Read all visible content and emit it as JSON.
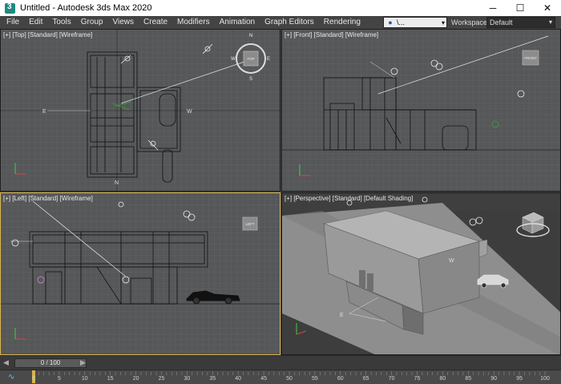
{
  "window": {
    "title": "Untitled - Autodesk 3ds Max 2020",
    "minimize_glyph": "─",
    "maximize_glyph": "☐",
    "close_glyph": "✕"
  },
  "menu": {
    "items": [
      {
        "label": "File"
      },
      {
        "label": "Edit"
      },
      {
        "label": "Tools"
      },
      {
        "label": "Group"
      },
      {
        "label": "Views"
      },
      {
        "label": "Create"
      },
      {
        "label": "Modifiers"
      },
      {
        "label": "Animation"
      },
      {
        "label": "Graph Editors"
      },
      {
        "label": "Rendering"
      }
    ],
    "user_value": "\\...",
    "workspaces_label": "Workspaces:",
    "workspaces_value": "Default"
  },
  "viewports": {
    "top": {
      "label": "[+] [Top] [Standard] [Wireframe]"
    },
    "front": {
      "label": "[+] [Front] [Standard] [Wireframe]"
    },
    "left": {
      "label": "[+] [Left] [Standard] [Wireframe]"
    },
    "perspective": {
      "label": "[+] [Perspective] [Standard] [Default Shading]"
    }
  },
  "viewcube": {
    "top_face": "TOP",
    "front_face": "FRONT",
    "left_face": "LEFT",
    "north": "N",
    "south": "S",
    "east": "E",
    "west": "W"
  },
  "timeline": {
    "frame_display": "0 / 100",
    "ticks": [
      "0",
      "5",
      "10",
      "15",
      "20",
      "25",
      "30",
      "35",
      "40",
      "45",
      "50",
      "55",
      "60",
      "65",
      "70",
      "75",
      "80",
      "85",
      "90",
      "95",
      "100"
    ]
  },
  "colors": {
    "active_border": "#d9b34a",
    "viewport_bg": "#555759",
    "grid": "#6a6c6e",
    "wire": "#111111"
  }
}
